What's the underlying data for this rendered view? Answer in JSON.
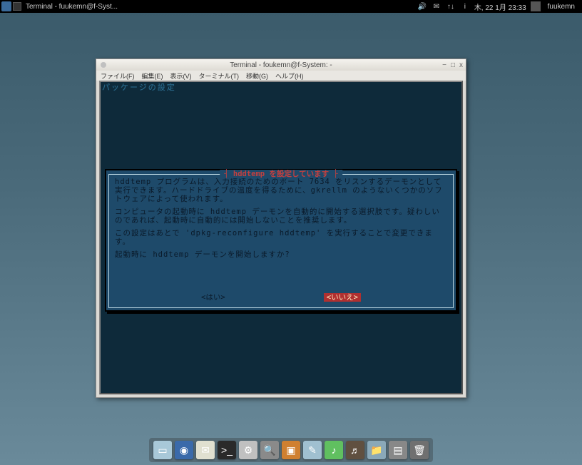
{
  "panel": {
    "task_title": "Terminal - fuukemn@f-Syst...",
    "datetime": "木, 22  1月  23:33",
    "username": "fuukemn",
    "tray": {
      "volume": "🔊",
      "mail": "✉",
      "net": "↑↓",
      "info": "i"
    }
  },
  "window": {
    "title": "Terminal - foukemn@f-System: -",
    "menu": {
      "file": "ファイル(F)",
      "edit": "編集(E)",
      "view": "表示(V)",
      "terminal": "ターミナル(T)",
      "go": "移動(G)",
      "help": "ヘルプ(H)"
    },
    "controls": {
      "min": "−",
      "max": "□",
      "close": "x"
    }
  },
  "terminal": {
    "pkg_header": "パッケージの設定"
  },
  "dialog": {
    "title": "┤ hddtemp を設定しています ├",
    "para1": "hddtemp プログラムは、入力接続のためのポート 7634 をリスンするデーモンとして実行できます。ハードドライブの温度を得るために、gkrellm のようないくつかのソフトウェアによって使われます。",
    "para2": "コンピュータの起動時に hddtemp デーモンを自動的に開始する選択肢です。疑わしいのであれば、起動時に自動的には開始しないことを推奨します。",
    "para3": "この設定はあとで 'dpkg-reconfigure hddtemp' を実行することで変更できます。",
    "question": "起動時に hddtemp デーモンを開始しますか?",
    "yes": "<はい>",
    "no": "<いいえ>"
  },
  "dock": {
    "filemanager": "▭",
    "web": "◉",
    "mail": "✉",
    "term": ">_",
    "settings": "⚙",
    "search": "🔍",
    "box": "▣",
    "notes": "✎",
    "music": "♪",
    "audio": "♬",
    "folder": "📁",
    "images": "▤",
    "trash": "🗑"
  }
}
